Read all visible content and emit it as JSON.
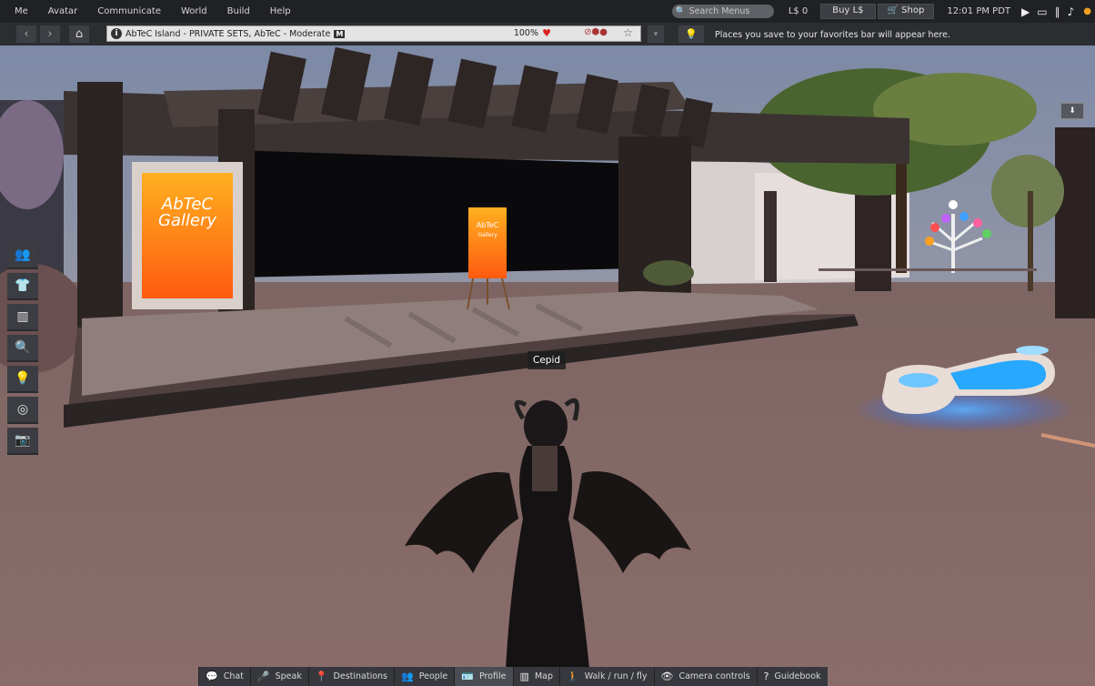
{
  "menu": {
    "items": [
      "Me",
      "Avatar",
      "Communicate",
      "World",
      "Build",
      "Help"
    ],
    "search_placeholder": "Search Menus",
    "balance": "L$ 0",
    "buy_label": "Buy L$",
    "shop_label": "Shop",
    "clock": "12:01 PM PDT"
  },
  "nav": {
    "location": "AbTeC Island - PRIVATE SETS, AbTeC - Moderate",
    "maturity_badge": "M",
    "zoom": "100%",
    "favorites_hint": "Places you save to your favorites bar will appear here."
  },
  "scene": {
    "avatar_name": "Cepid",
    "sign_large_line1": "AbTeC",
    "sign_large_line2": "Gallery",
    "sign_small_line1": "AbTeC",
    "sign_small_line2": "Gallery"
  },
  "left_toolbar": [
    {
      "name": "people-icon",
      "glyph": "👥"
    },
    {
      "name": "shirt-icon",
      "glyph": "👕"
    },
    {
      "name": "inventory-icon",
      "glyph": "▥"
    },
    {
      "name": "search-icon",
      "glyph": "🔍"
    },
    {
      "name": "lightbulb-icon",
      "glyph": "💡"
    },
    {
      "name": "radio-icon",
      "glyph": "◎"
    },
    {
      "name": "camera-icon",
      "glyph": "📷"
    }
  ],
  "bottom_bar": [
    {
      "label": "Chat",
      "icon": "chat-icon",
      "glyph": "💬"
    },
    {
      "label": "Speak",
      "icon": "microphone-icon",
      "glyph": "🎤"
    },
    {
      "label": "Destinations",
      "icon": "pin-icon",
      "glyph": "📍"
    },
    {
      "label": "People",
      "icon": "people-icon",
      "glyph": "👥"
    },
    {
      "label": "Profile",
      "icon": "profile-icon",
      "glyph": "🪪"
    },
    {
      "label": "Map",
      "icon": "map-icon",
      "glyph": "▥"
    },
    {
      "label": "Walk / run / fly",
      "icon": "walk-icon",
      "glyph": "🚶"
    },
    {
      "label": "Camera controls",
      "icon": "eye-icon",
      "glyph": "👁"
    },
    {
      "label": "Guidebook",
      "icon": "guidebook-icon",
      "glyph": "?"
    }
  ]
}
